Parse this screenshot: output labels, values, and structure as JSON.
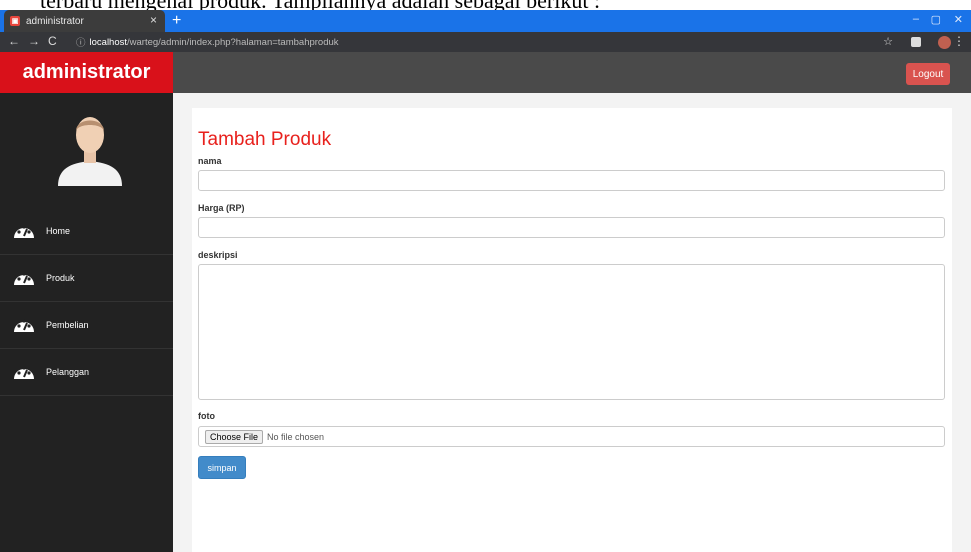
{
  "document": {
    "partial_text": "terbaru mengenai produk. Tampilannya adalah sebagai berikut :"
  },
  "browser": {
    "tab_title": "administrator",
    "url_host": "localhost",
    "url_path": "/warteg/admin/index.php?halaman=tambahproduk"
  },
  "app": {
    "brand": "administrator",
    "logout_label": "Logout",
    "accent": "#d9111a"
  },
  "sidebar": {
    "items": [
      {
        "label": "Home",
        "icon": "dashboard-icon"
      },
      {
        "label": "Produk",
        "icon": "dashboard-icon"
      },
      {
        "label": "Pembelian",
        "icon": "dashboard-icon"
      },
      {
        "label": "Pelanggan",
        "icon": "dashboard-icon"
      }
    ]
  },
  "form": {
    "title": "Tambah Produk",
    "nama_label": "nama",
    "harga_label": "Harga (RP)",
    "deskripsi_label": "deskripsi",
    "foto_label": "foto",
    "choose_file_label": "Choose File",
    "no_file_text": "No file chosen",
    "submit_label": "simpan"
  }
}
